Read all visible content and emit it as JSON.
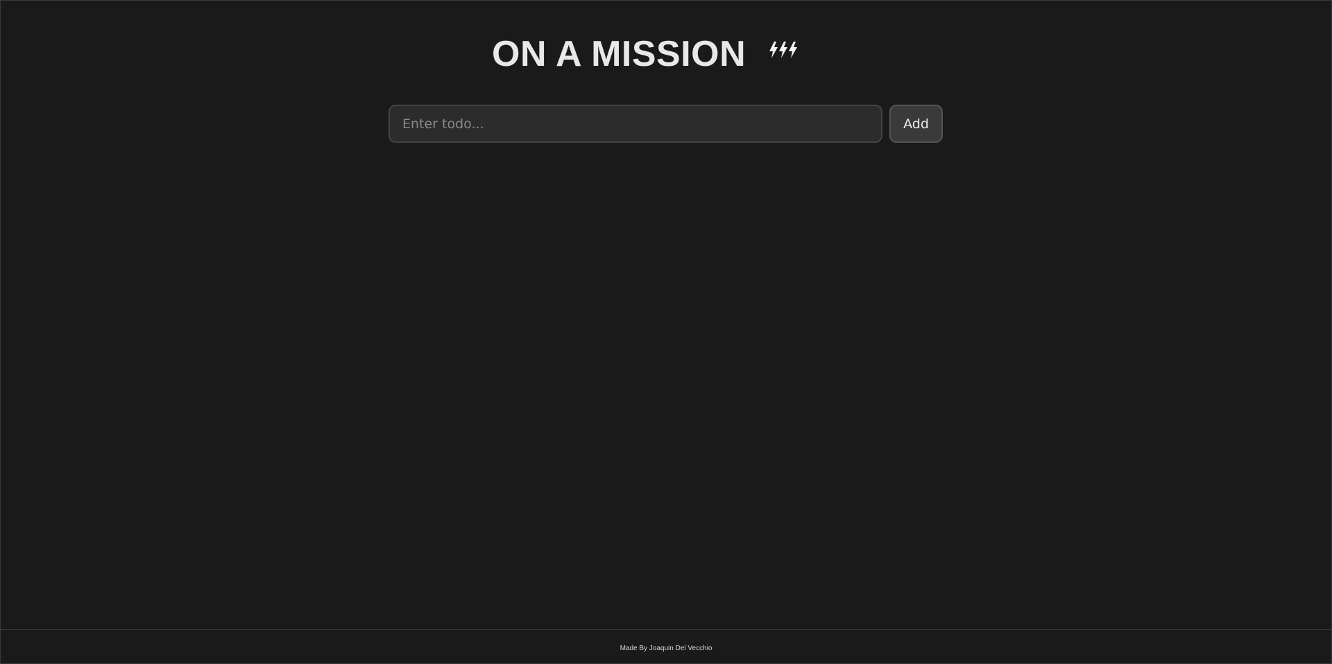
{
  "header": {
    "title": "ON A MISSION",
    "logo_icon": "lightning-bolts-icon"
  },
  "todo_form": {
    "input_value": "",
    "input_placeholder": "Enter todo...",
    "add_label": "Add"
  },
  "footer": {
    "credit": "Made By Joaquin Del Vecchio"
  },
  "colors": {
    "background": "#1a1a1a",
    "input_background": "#2c2c2c",
    "button_background": "#3a3a3a",
    "text": "#e8e8e8"
  }
}
